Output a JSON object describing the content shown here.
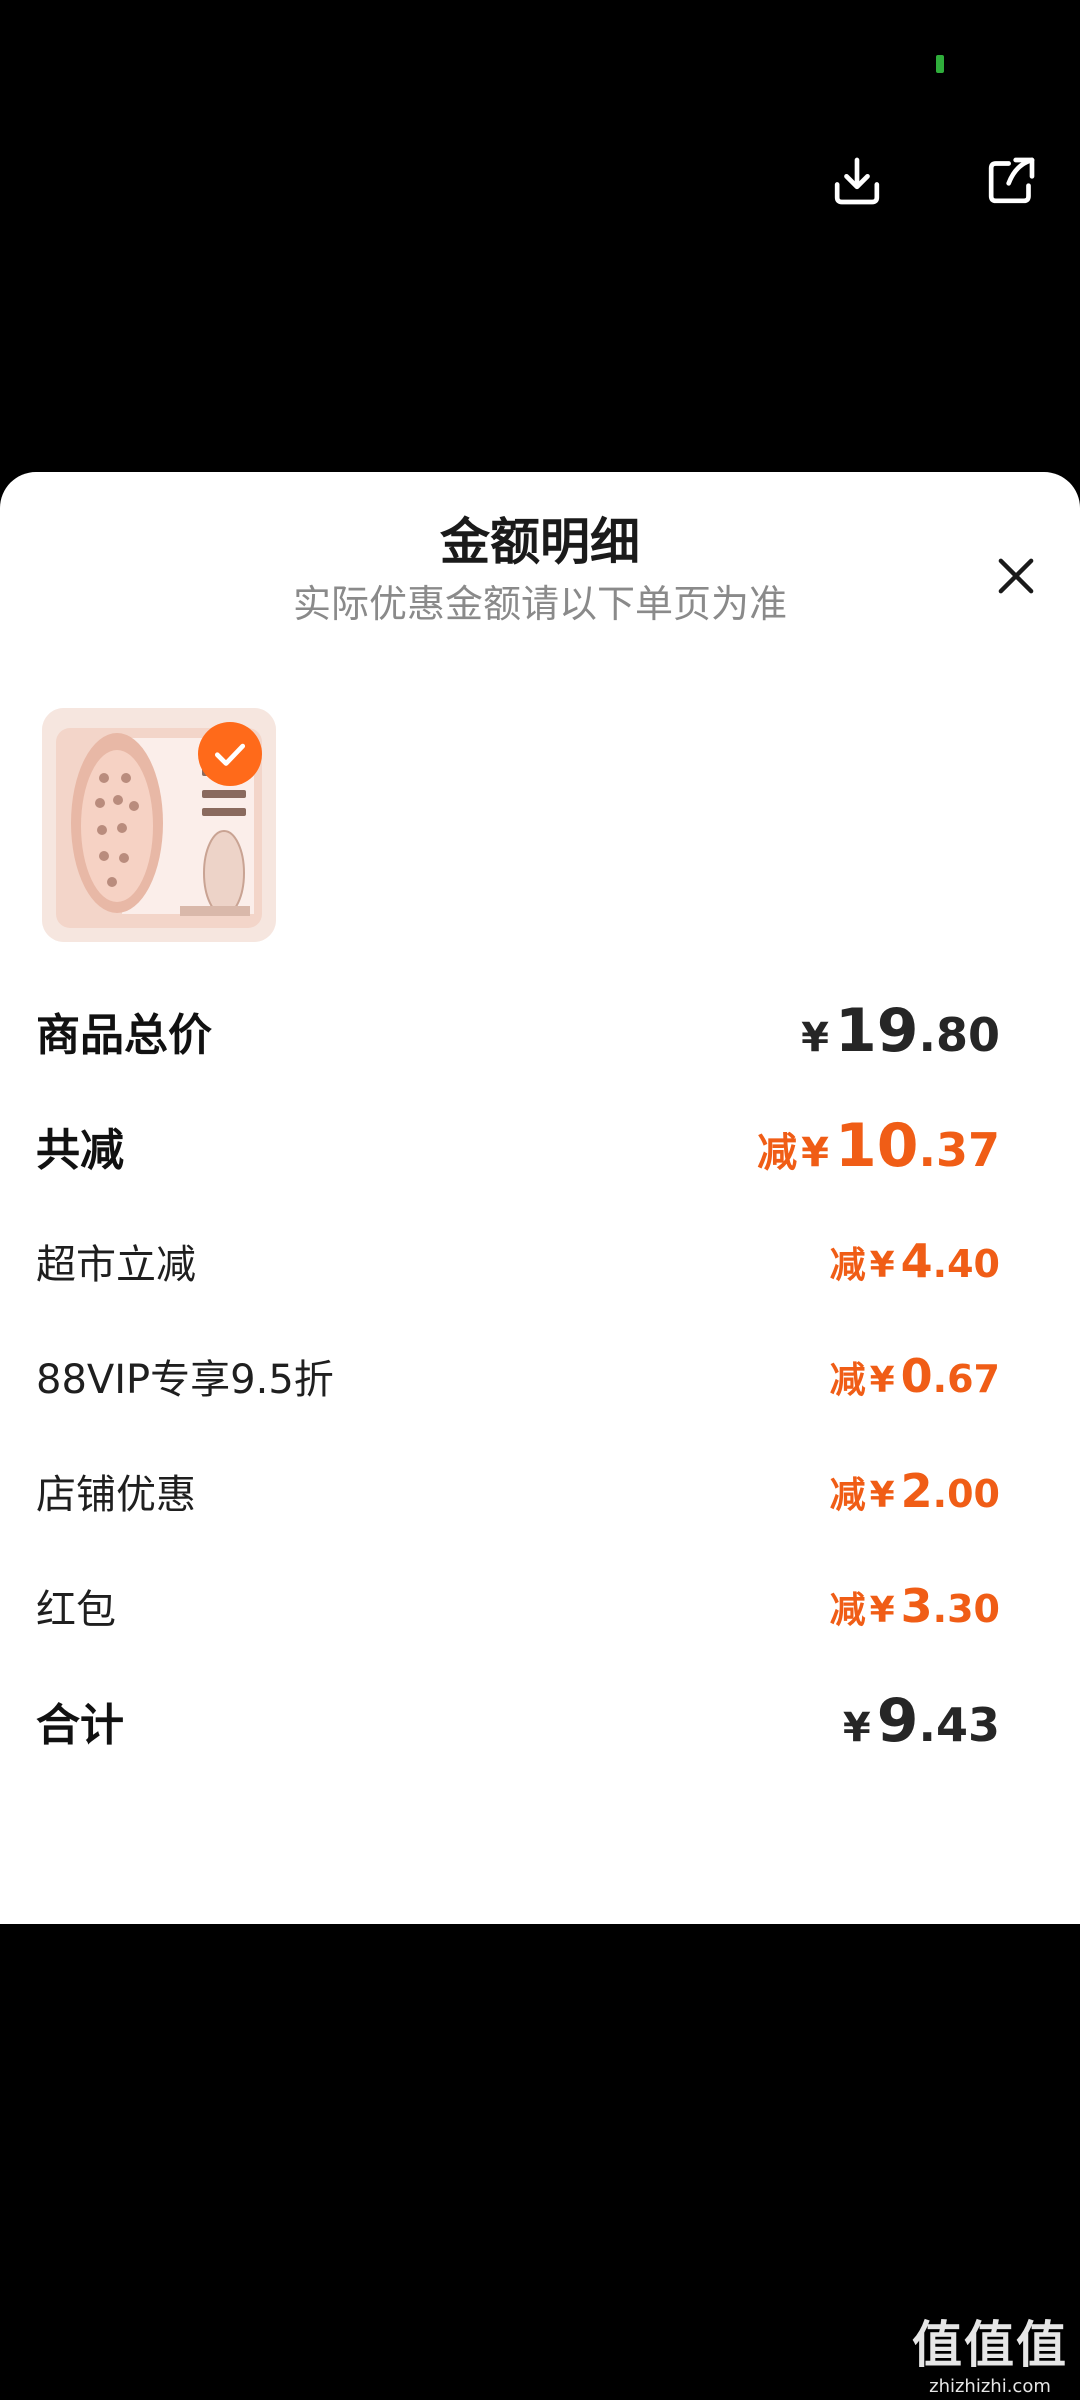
{
  "header": {
    "download_icon": "download-icon",
    "share_icon": "share-icon"
  },
  "sheet": {
    "title": "金额明细",
    "subtitle": "实际优惠金额请以下单页为准",
    "close_icon": "close-icon"
  },
  "product": {
    "thumbnail_icon": "product-thumbnail",
    "selected_icon": "check-icon"
  },
  "rows": [
    {
      "label": "商品总价",
      "prefix": "",
      "yen": "¥",
      "int": "19",
      "dec": ".80"
    },
    {
      "label": "共减",
      "prefix": "减",
      "yen": "¥",
      "int": "10",
      "dec": ".37"
    },
    {
      "label": "超市立减",
      "prefix": "减",
      "yen": "¥",
      "int": "4",
      "dec": ".40"
    },
    {
      "label": "88VIP专享9.5折",
      "prefix": "减",
      "yen": "¥",
      "int": "0",
      "dec": ".67"
    },
    {
      "label": "店铺优惠",
      "prefix": "减",
      "yen": "¥",
      "int": "2",
      "dec": ".00"
    },
    {
      "label": "红包",
      "prefix": "减",
      "yen": "¥",
      "int": "3",
      "dec": ".30"
    },
    {
      "label": "合计",
      "prefix": "",
      "yen": "¥",
      "int": "9",
      "dec": ".43"
    }
  ],
  "watermark": {
    "main": "值值值",
    "site": "zhizhizhi.com"
  },
  "colors": {
    "accent": "#f05d16",
    "badge": "#ff6a1a",
    "status_dot": "#2fae3b"
  }
}
